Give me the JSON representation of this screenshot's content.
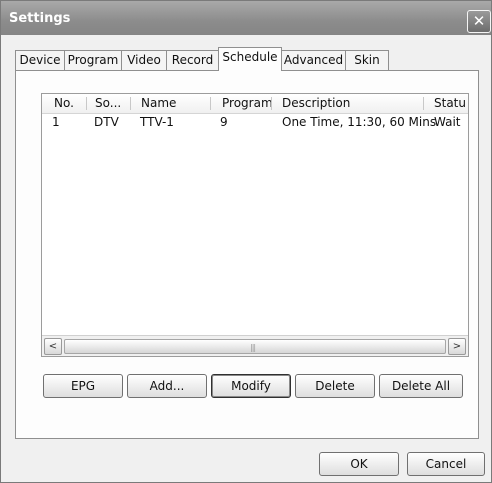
{
  "window": {
    "title": "Settings",
    "close_glyph": "✕"
  },
  "tabs": [
    {
      "label": "Device"
    },
    {
      "label": "Program"
    },
    {
      "label": "Video"
    },
    {
      "label": "Record"
    },
    {
      "label": "Schedule",
      "active": true
    },
    {
      "label": "Advanced"
    },
    {
      "label": "Skin"
    }
  ],
  "schedule_list": {
    "columns": [
      "No.",
      "So...",
      "Name",
      "Program",
      "Description",
      "Statu"
    ],
    "rows": [
      {
        "no": "1",
        "source": "DTV",
        "name": "TTV-1",
        "program": "9",
        "description": "One Time, 11:30, 60 Mins",
        "status": "Wait"
      }
    ]
  },
  "scrollbar": {
    "left_arrow": "<",
    "right_arrow": ">",
    "grip": "|||"
  },
  "actions": {
    "epg": "EPG",
    "add": "Add...",
    "modify": "Modify",
    "delete": "Delete",
    "delete_all": "Delete All"
  },
  "dialog": {
    "ok": "OK",
    "cancel": "Cancel"
  },
  "icons": {
    "close": "close-icon",
    "scroll_left": "arrow-left-icon",
    "scroll_right": "arrow-right-icon"
  }
}
